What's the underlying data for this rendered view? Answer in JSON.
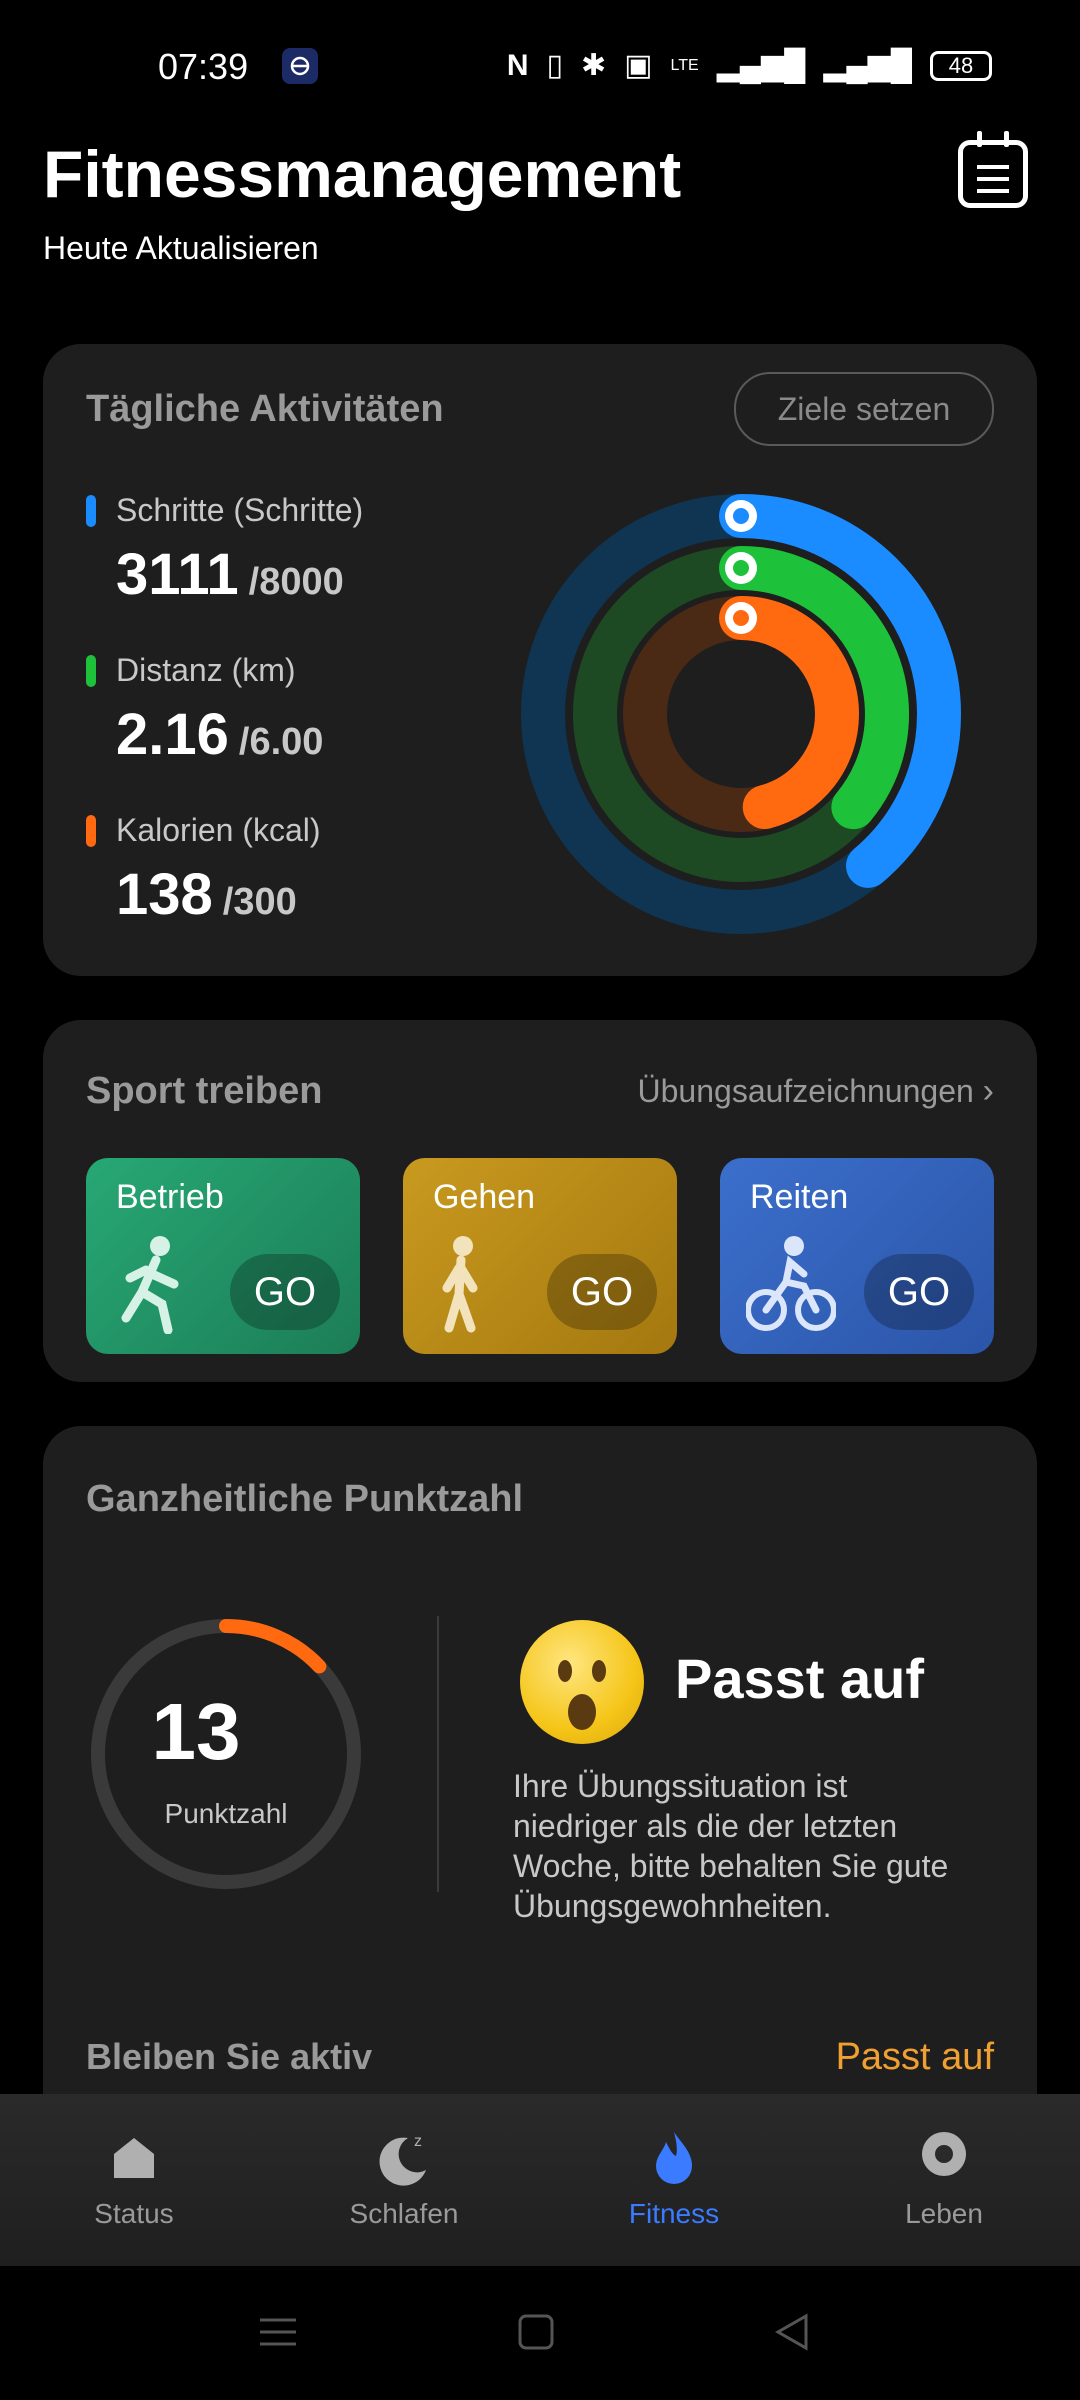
{
  "status_bar": {
    "time": "07:39",
    "network": "LTE",
    "battery": "48"
  },
  "header": {
    "title": "Fitnessmanagement",
    "subtitle": "Heute Aktualisieren"
  },
  "daily": {
    "title": "Tägliche Aktivitäten",
    "goal_button": "Ziele setzen",
    "metrics": [
      {
        "label": "Schritte (Schritte)",
        "value": "3111",
        "goal": "/8000",
        "color": "#1a8cff",
        "progress": 0.389
      },
      {
        "label": "Distanz (km)",
        "value": "2.16",
        "goal": "/6.00",
        "color": "#1ec23a",
        "progress": 0.36
      },
      {
        "label": "Kalorien (kcal)",
        "value": "138",
        "goal": "/300",
        "color": "#ff6a10",
        "progress": 0.46
      }
    ]
  },
  "sport": {
    "title": "Sport treiben",
    "records_link": "Übungsaufzeichnungen",
    "items": [
      {
        "name": "Betrieb",
        "go": "GO",
        "icon": "running-icon"
      },
      {
        "name": "Gehen",
        "go": "GO",
        "icon": "walking-icon"
      },
      {
        "name": "Reiten",
        "go": "GO",
        "icon": "cycling-icon"
      }
    ]
  },
  "overall": {
    "title": "Ganzheitliche Punktzahl",
    "score": "13",
    "score_label": "Punktzahl",
    "score_progress": 0.13,
    "status": "Passt auf",
    "message": "Ihre Übungssituation ist niedriger als die der letzten Woche, bitte behalten Sie gute Übungsgewohnheiten.",
    "stay_active_label": "Bleiben Sie aktiv",
    "stay_active_value": "Passt auf"
  },
  "nav": {
    "items": [
      {
        "label": "Status",
        "icon": "home-icon",
        "active": false
      },
      {
        "label": "Schlafen",
        "icon": "moon-icon",
        "active": false
      },
      {
        "label": "Fitness",
        "icon": "flame-icon",
        "active": true
      },
      {
        "label": "Leben",
        "icon": "location-icon",
        "active": false
      }
    ]
  },
  "colors": {
    "accent_blue": "#3a7bff",
    "steps": "#1a8cff",
    "distance": "#1ec23a",
    "calories": "#ff6a10",
    "warning": "#f0a030"
  }
}
